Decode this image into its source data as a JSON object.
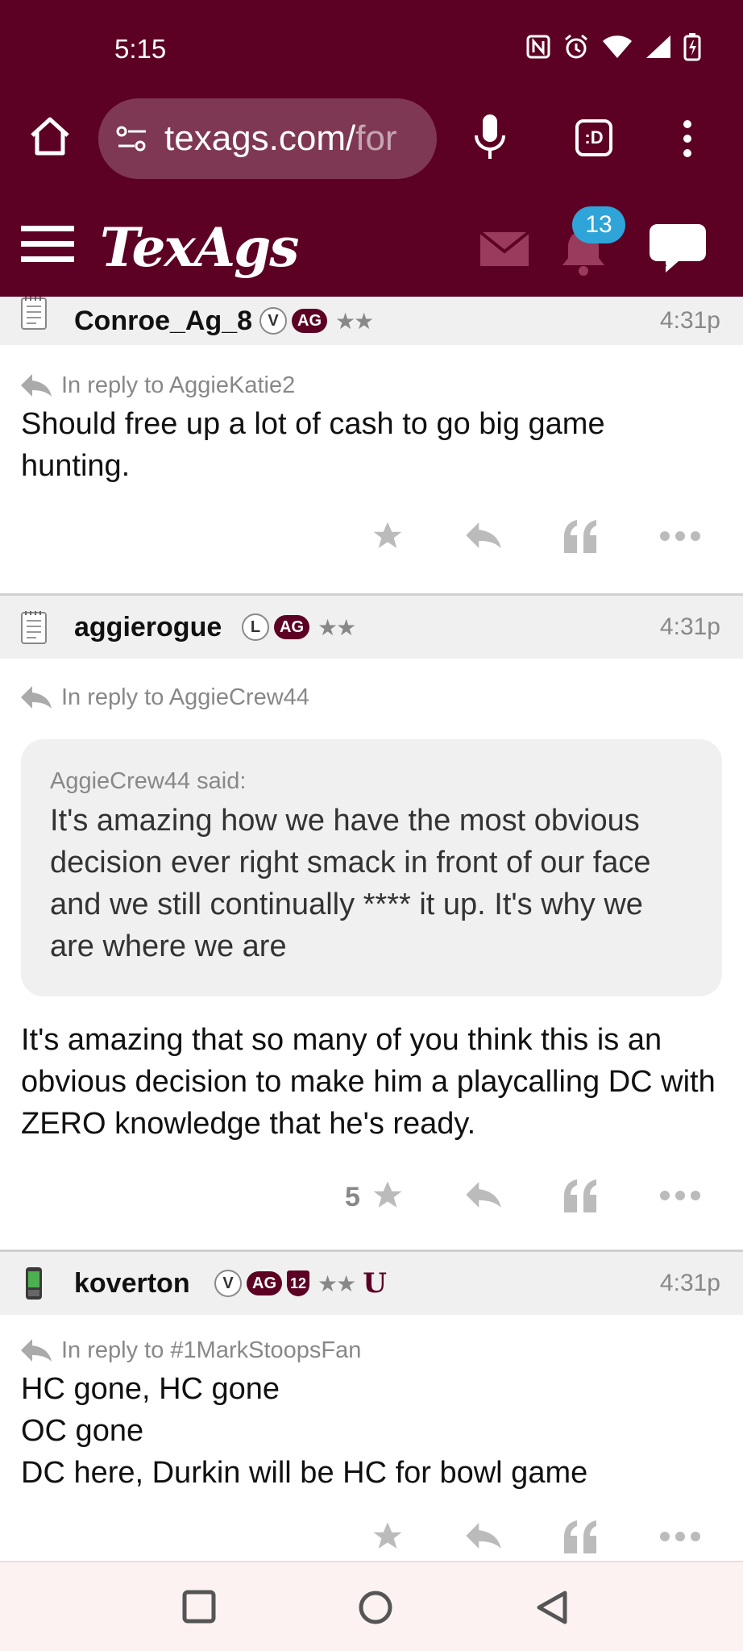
{
  "status_bar": {
    "time": "5:15"
  },
  "browser": {
    "url_main": "texags.com/",
    "url_faded": "for",
    "tabs_label": ":D"
  },
  "site": {
    "logo": "TexAgs",
    "notification_count": "13"
  },
  "posts": [
    {
      "username": "Conroe_Ag_8",
      "badges": [
        "V",
        "AG",
        "★★"
      ],
      "time": "4:31p",
      "reply_to": "In reply to AggieKatie2",
      "body": "Should free up a lot of cash to go big game hunting.",
      "stars": ""
    },
    {
      "username": "aggierogue",
      "badges": [
        "L",
        "AG",
        "★★"
      ],
      "time": "4:31p",
      "reply_to": "In reply to AggieCrew44",
      "quote_author": "AggieCrew44 said:",
      "quote": "It's amazing how we have the most obvious decision ever right smack in front of our face and we still continually **** it up. It's why we are where we are",
      "body": "It's amazing that so many of you think this is an obvious decision to make him a playcalling DC with ZERO knowledge that he's ready.",
      "stars": "5"
    },
    {
      "username": "koverton",
      "badges": [
        "V",
        "AG",
        "12",
        "★★",
        "U"
      ],
      "time": "4:31p",
      "reply_to": "In reply to #1MarkStoopsFan",
      "body_lines": [
        "HC gone, HC gone",
        "OC gone",
        "DC here, Durkin will be HC for bowl game"
      ],
      "stars": ""
    }
  ],
  "colors": {
    "maroon": "#5c0124",
    "badge_blue": "#2fa4d8",
    "muted": "#888888"
  }
}
